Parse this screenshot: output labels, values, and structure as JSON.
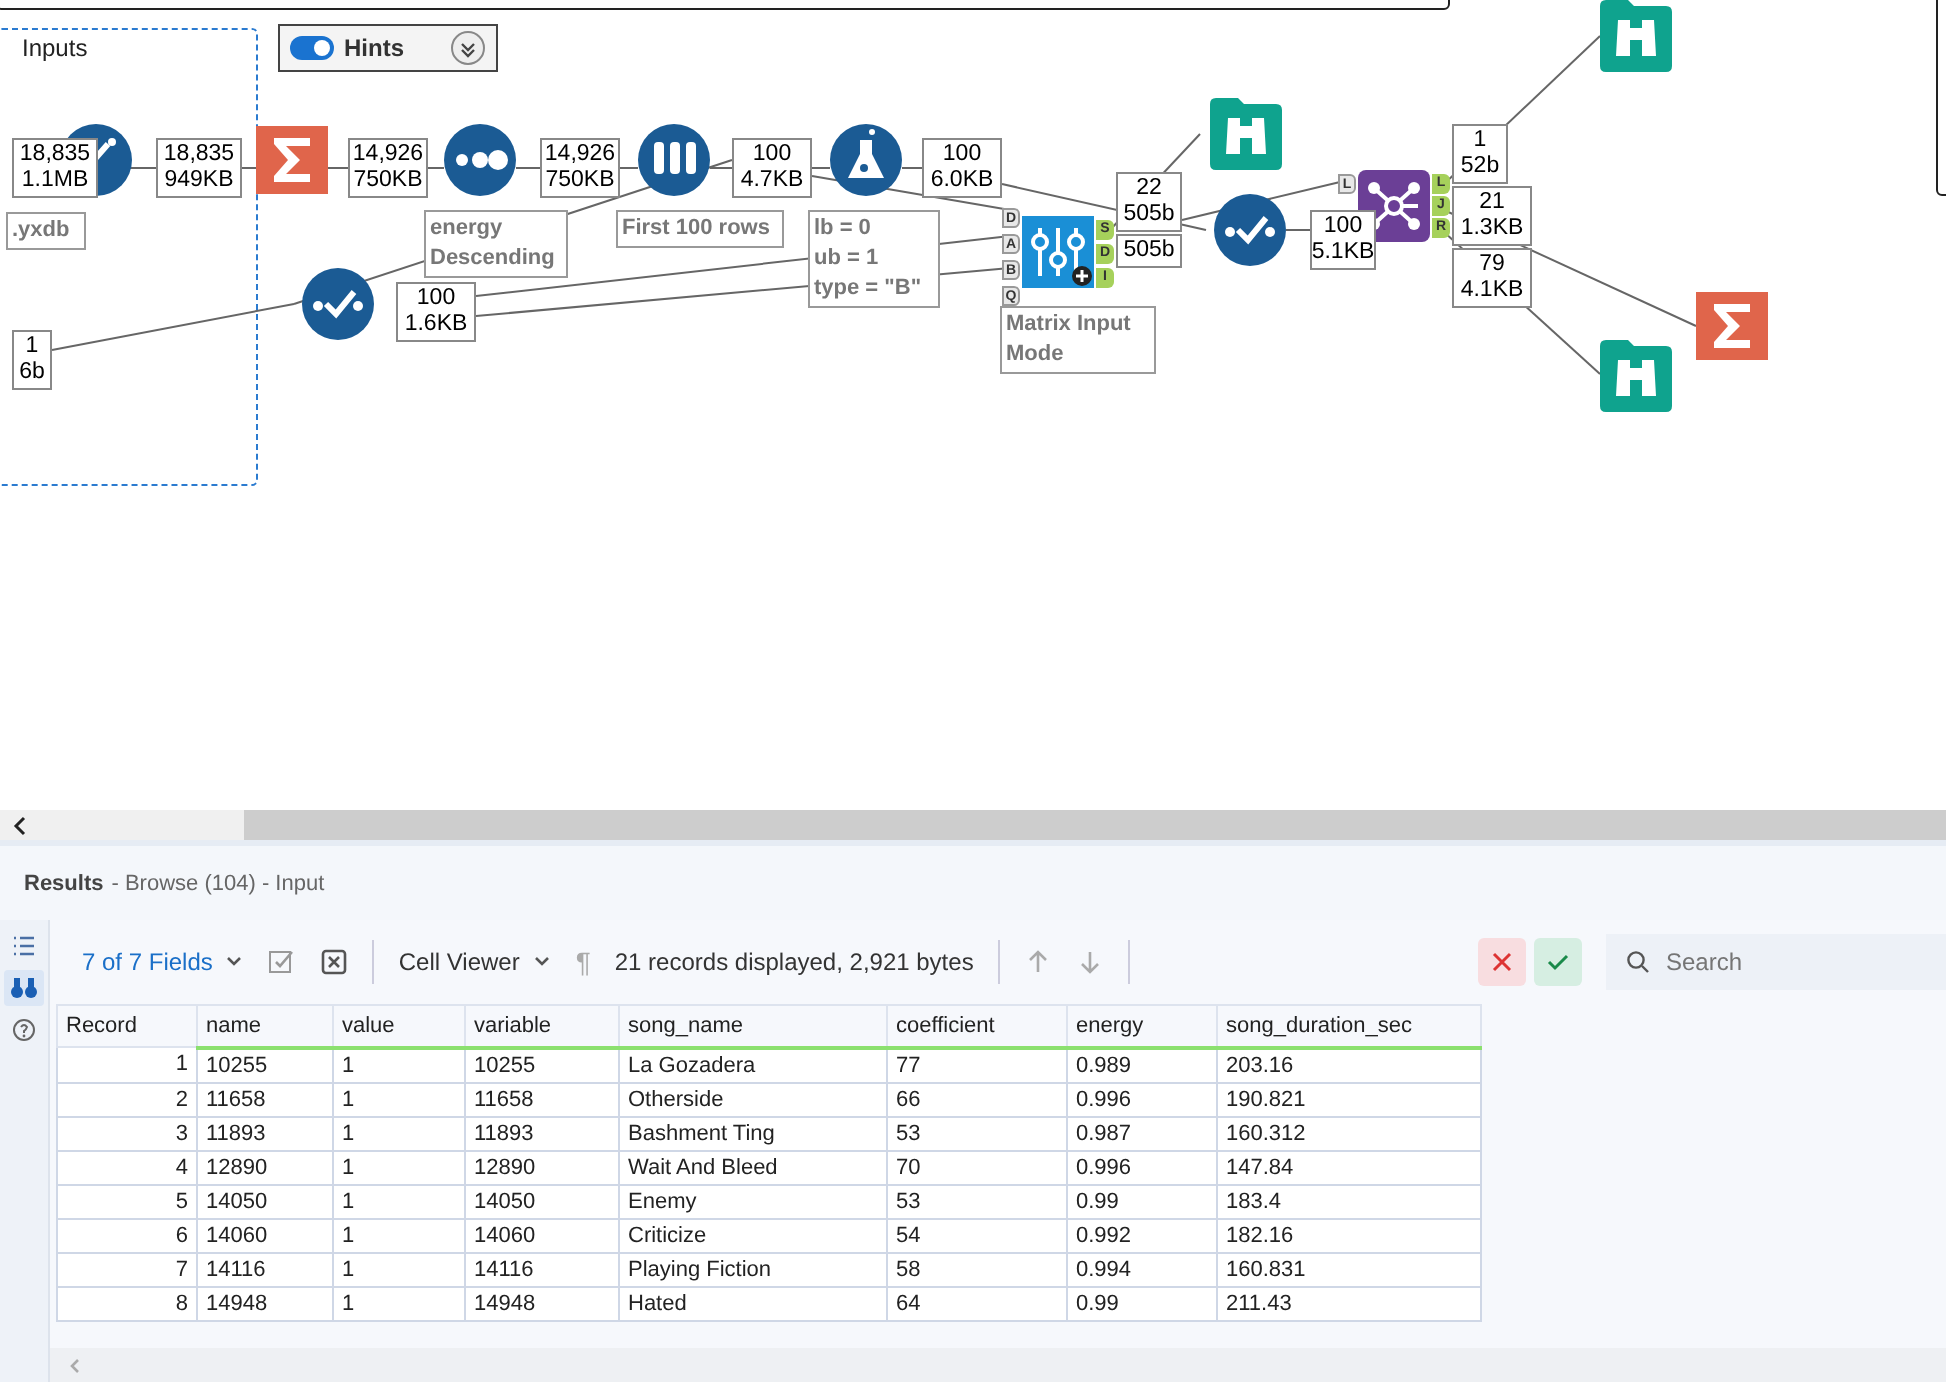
{
  "canvas": {
    "container": {
      "title": "Inputs"
    },
    "hints": {
      "label": "Hints",
      "on": true
    },
    "tools": [
      {
        "kind": "select"
      },
      {
        "kind": "summarize"
      },
      {
        "kind": "sort"
      },
      {
        "kind": "sample"
      },
      {
        "kind": "formula"
      },
      {
        "kind": "check"
      },
      {
        "kind": "optimization",
        "inputs": [
          "D",
          "A",
          "B",
          "Q"
        ],
        "outputs": [
          "S",
          "D",
          "I"
        ]
      },
      {
        "kind": "browse"
      },
      {
        "kind": "check"
      },
      {
        "kind": "join",
        "inputs": [
          "L"
        ],
        "outputs": [
          "L",
          "J",
          "R"
        ]
      },
      {
        "kind": "browse"
      },
      {
        "kind": "browse"
      },
      {
        "kind": "summarize"
      }
    ],
    "badges": [
      {
        "lines": [
          "18,835",
          "1.1MB"
        ]
      },
      {
        "lines": [
          "18,835",
          "949KB"
        ]
      },
      {
        "lines": [
          "14,926",
          "750KB"
        ]
      },
      {
        "lines": [
          "14,926",
          "750KB"
        ]
      },
      {
        "lines": [
          "100",
          "4.7KB"
        ]
      },
      {
        "lines": [
          "100",
          "6.0KB"
        ]
      },
      {
        "lines": [
          "1",
          "6b"
        ]
      },
      {
        "lines": [
          "100",
          "1.6KB"
        ]
      },
      {
        "lines": [
          "22",
          "505b"
        ]
      },
      {
        "lines": [
          "505b"
        ]
      },
      {
        "lines": [
          "100",
          "5.1KB"
        ]
      },
      {
        "lines": [
          "1",
          "52b"
        ]
      },
      {
        "lines": [
          "21",
          "1.3KB"
        ]
      },
      {
        "lines": [
          "79",
          "4.1KB"
        ]
      }
    ],
    "annotations": [
      {
        "lines": [
          ".yxdb"
        ]
      },
      {
        "lines": [
          "energy",
          "Descending"
        ]
      },
      {
        "lines": [
          "First 100 rows"
        ]
      },
      {
        "lines": [
          "lb = 0",
          "ub = 1",
          "type = \"B\""
        ]
      },
      {
        "lines": [
          "Matrix Input",
          "Mode"
        ]
      }
    ]
  },
  "results": {
    "title": "Results",
    "subtitle": "- Browse (104) - Input",
    "rail": [
      {
        "kind": "list",
        "selected": false
      },
      {
        "kind": "browse",
        "selected": true
      },
      {
        "kind": "help",
        "selected": false
      }
    ],
    "toolbar": {
      "fields": "7 of 7 Fields",
      "viewer": "Cell Viewer",
      "pilcrow": "¶",
      "summary": "21 records displayed, 2,921 bytes",
      "search": {
        "placeholder": "Search"
      }
    },
    "table": {
      "columns": [
        "Record",
        "name",
        "value",
        "variable",
        "song_name",
        "coefficient",
        "energy",
        "song_duration_sec"
      ],
      "rows": [
        [
          "1",
          "10255",
          "1",
          "10255",
          "La Gozadera",
          "77",
          "0.989",
          "203.16"
        ],
        [
          "2",
          "11658",
          "1",
          "11658",
          "Otherside",
          "66",
          "0.996",
          "190.821"
        ],
        [
          "3",
          "11893",
          "1",
          "11893",
          "Bashment Ting",
          "53",
          "0.987",
          "160.312"
        ],
        [
          "4",
          "12890",
          "1",
          "12890",
          "Wait And Bleed",
          "70",
          "0.996",
          "147.84"
        ],
        [
          "5",
          "14050",
          "1",
          "14050",
          "Enemy",
          "53",
          "0.99",
          "183.4"
        ],
        [
          "6",
          "14060",
          "1",
          "14060",
          "Criticize",
          "54",
          "0.992",
          "182.16"
        ],
        [
          "7",
          "14116",
          "1",
          "14116",
          "Playing Fiction",
          "58",
          "0.994",
          "160.831"
        ],
        [
          "8",
          "14948",
          "1",
          "14948",
          "Hated",
          "64",
          "0.99",
          "211.43"
        ]
      ]
    }
  }
}
